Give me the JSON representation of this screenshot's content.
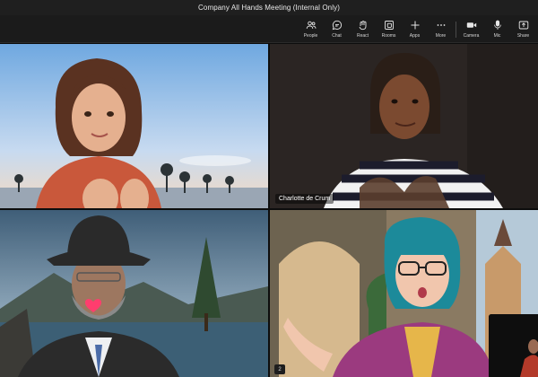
{
  "window": {
    "title": "Company All Hands Meeting (Internal Only)"
  },
  "toolbar": {
    "items": [
      {
        "label": "People",
        "icon": "people-icon"
      },
      {
        "label": "Chat",
        "icon": "chat-icon"
      },
      {
        "label": "React",
        "icon": "react-icon"
      },
      {
        "label": "Rooms",
        "icon": "rooms-icon"
      },
      {
        "label": "Apps",
        "icon": "plus-icon"
      },
      {
        "label": "More",
        "icon": "more-icon"
      },
      {
        "label": "Camera",
        "icon": "camera-icon"
      },
      {
        "label": "Mic",
        "icon": "mic-icon"
      },
      {
        "label": "Share",
        "icon": "share-icon"
      }
    ]
  },
  "participants": [
    {
      "name": "",
      "scene": "beach avatar"
    },
    {
      "name": "Charlotte de Crum",
      "scene": "dark studio avatar"
    },
    {
      "name": "",
      "scene": "mountain lake avatar with cowboy hat"
    },
    {
      "name": "",
      "scene": "castle avatar with glasses"
    }
  ],
  "self_view_badge": "2"
}
